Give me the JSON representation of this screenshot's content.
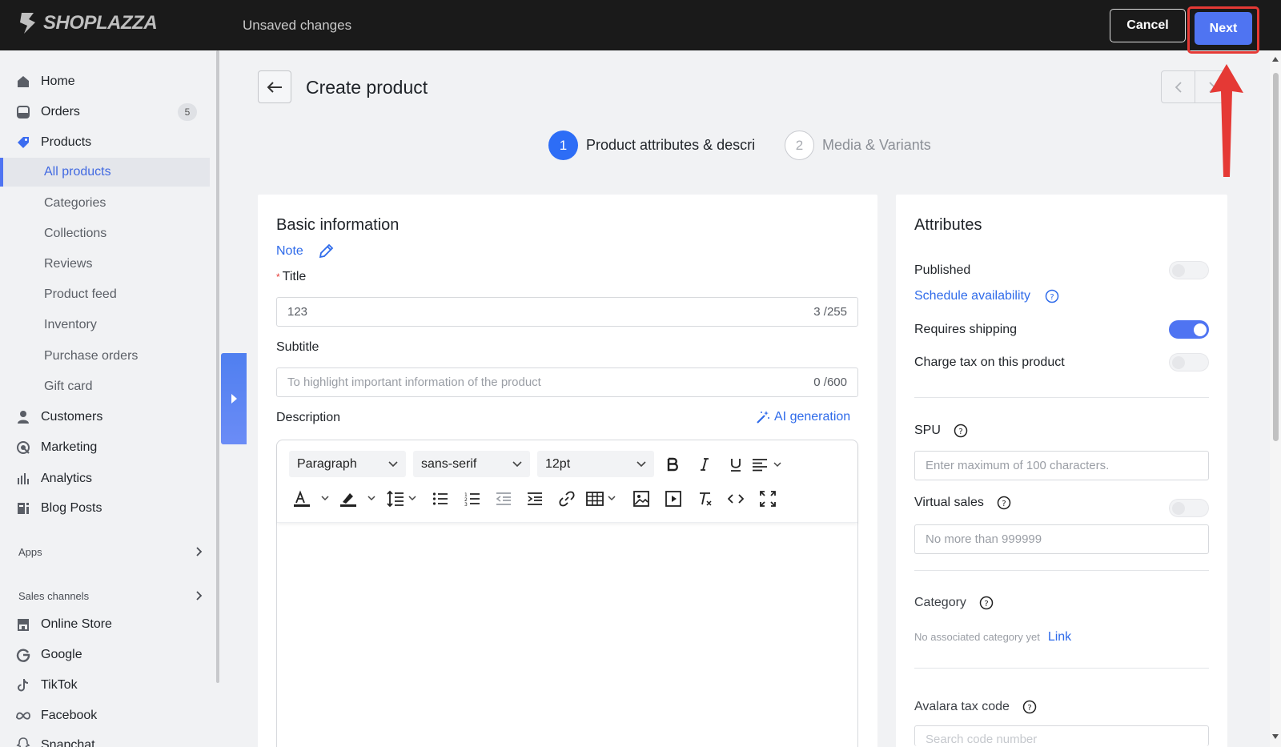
{
  "topbar": {
    "logo_text": "SHOPLAZZA",
    "status": "Unsaved changes",
    "cancel_label": "Cancel",
    "next_label": "Next"
  },
  "sidebar": {
    "items": [
      {
        "label": "Home",
        "icon": "home-icon"
      },
      {
        "label": "Orders",
        "icon": "orders-icon",
        "badge": "5"
      },
      {
        "label": "Products",
        "icon": "tag-icon"
      }
    ],
    "product_sub": [
      {
        "label": "All products",
        "active": true
      },
      {
        "label": "Categories"
      },
      {
        "label": "Collections"
      },
      {
        "label": "Reviews"
      },
      {
        "label": "Product feed"
      },
      {
        "label": "Inventory"
      },
      {
        "label": "Purchase orders"
      },
      {
        "label": "Gift card"
      }
    ],
    "items2": [
      {
        "label": "Customers",
        "icon": "person-icon"
      },
      {
        "label": "Marketing",
        "icon": "marketing-icon"
      },
      {
        "label": "Analytics",
        "icon": "bar-chart-icon"
      },
      {
        "label": "Blog Posts",
        "icon": "blog-icon"
      }
    ],
    "apps_label": "Apps",
    "sales_channels_label": "Sales channels",
    "channels": [
      {
        "label": "Online Store",
        "icon": "store-icon"
      },
      {
        "label": "Google",
        "icon": "google-icon"
      },
      {
        "label": "TikTok",
        "icon": "tiktok-icon"
      },
      {
        "label": "Facebook",
        "icon": "meta-icon"
      },
      {
        "label": "Snapchat",
        "icon": "snapchat-icon"
      }
    ]
  },
  "page": {
    "title": "Create product",
    "steps": [
      {
        "num": "1",
        "label": "Product attributes & descri",
        "active": true
      },
      {
        "num": "2",
        "label": "Media & Variants",
        "active": false
      }
    ]
  },
  "basic": {
    "heading": "Basic information",
    "note_link": "Note",
    "title_label": "Title",
    "title_required_mark": "*",
    "title_value": "123",
    "title_count": "3 /255",
    "subtitle_label": "Subtitle",
    "subtitle_placeholder": "To highlight important information of the product",
    "subtitle_count": "0 /600",
    "description_label": "Description",
    "ai_label": "AI generation",
    "editor": {
      "block_format": "Paragraph",
      "font_family": "sans-serif",
      "font_size": "12pt"
    }
  },
  "attributes": {
    "heading": "Attributes",
    "published_label": "Published",
    "published_on": false,
    "schedule_link": "Schedule availability",
    "requires_shipping_label": "Requires shipping",
    "requires_shipping_on": true,
    "charge_tax_label": "Charge tax on this product",
    "charge_tax_on": false,
    "spu_label": "SPU",
    "spu_placeholder": "Enter maximum of 100 characters.",
    "virtual_sales_label": "Virtual sales",
    "virtual_sales_on": false,
    "virtual_sales_placeholder": "No more than 999999",
    "category_label": "Category",
    "category_empty": "No associated category yet",
    "category_link": "Link",
    "avalara_label": "Avalara tax code",
    "avalara_placeholder": "Search code number"
  },
  "colors": {
    "accent": "#4f74f2",
    "annotation": "#e53935"
  }
}
